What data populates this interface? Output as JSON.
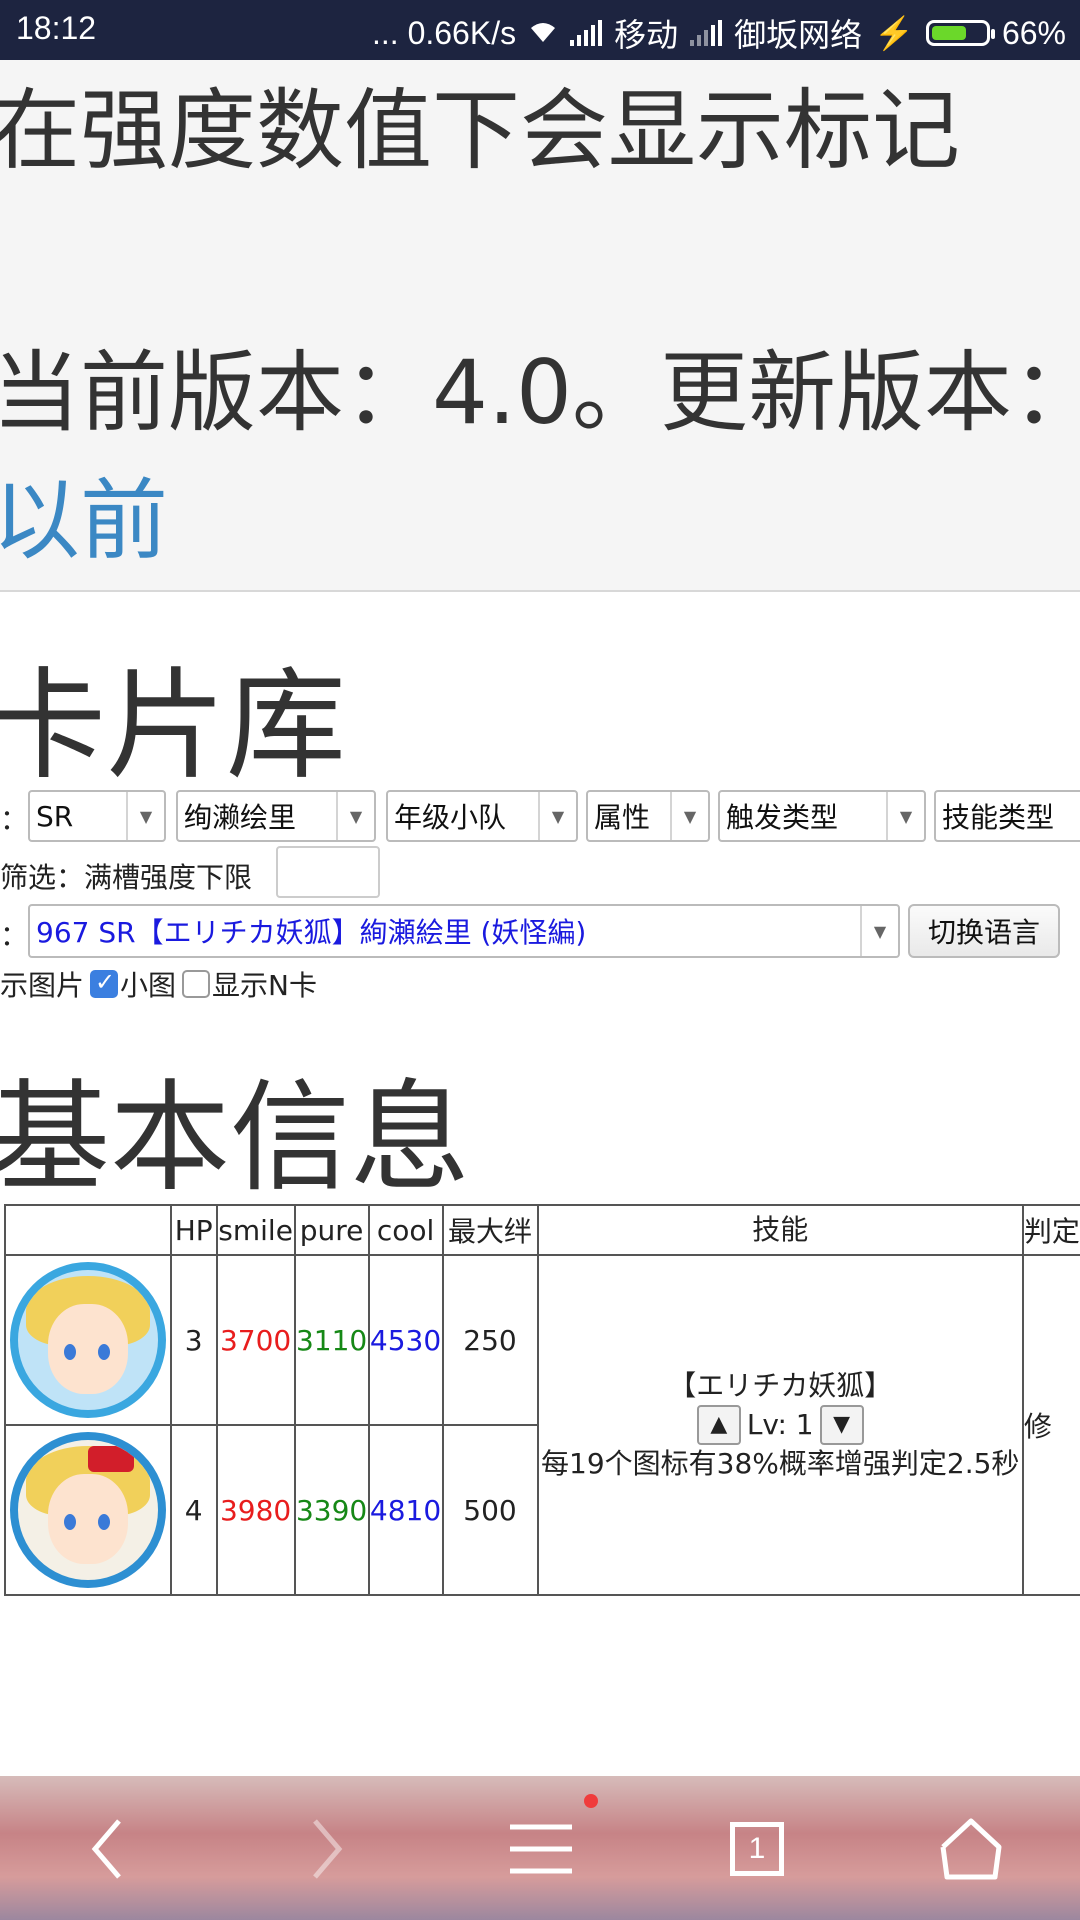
{
  "status_bar": {
    "time": "18:12",
    "network_speed": "... 0.66K/s",
    "carrier1": "移动",
    "carrier2": "御坂网络",
    "battery": "66%",
    "battery_level": 0.66
  },
  "notice": {
    "line1": "在强度数值下会显示标记",
    "line2": "当前版本：4.0。更新版本：",
    "link": "以前"
  },
  "library": {
    "title": "卡片库",
    "colon1": "：",
    "filters": [
      "SR",
      "绚濑绘里",
      "年级小队",
      "属性",
      "触发类型",
      "技能类型"
    ],
    "strength_filter_label": "筛选：满槽强度下限",
    "strength_filter_value": "",
    "colon2": "：",
    "card_select": "967 SR【エリチカ妖狐】絢瀬絵里 (妖怪編)",
    "switch_lang_button": "切换语言",
    "show_images_label": "示图片",
    "show_images_checked": true,
    "small_image_label": "小图",
    "show_n_label": "显示N卡",
    "show_n_checked": false
  },
  "basic_info": {
    "title": "基本信息",
    "headers": [
      "",
      "HP",
      "smile",
      "pure",
      "cool",
      "最大绊",
      "技能",
      "判定"
    ],
    "rows": [
      {
        "hp": "3",
        "smile": "3700",
        "pure": "3110",
        "cool": "4530",
        "bond": "250"
      },
      {
        "hp": "4",
        "smile": "3980",
        "pure": "3390",
        "cool": "4810",
        "bond": "500"
      }
    ],
    "skill_name": "【エリチカ妖狐】",
    "skill_lv": "Lv: 1",
    "skill_desc": "每19个图标有38%概率增强判定2.5秒",
    "judge_text": "修"
  },
  "bottom_nav": {
    "tab_count": "1",
    "colors": {
      "dot": "#f03c3c"
    }
  },
  "colors": {
    "smile": "#e81d1d",
    "pure": "#168816",
    "cool": "#1a1adf",
    "link": "#3b88c4"
  }
}
